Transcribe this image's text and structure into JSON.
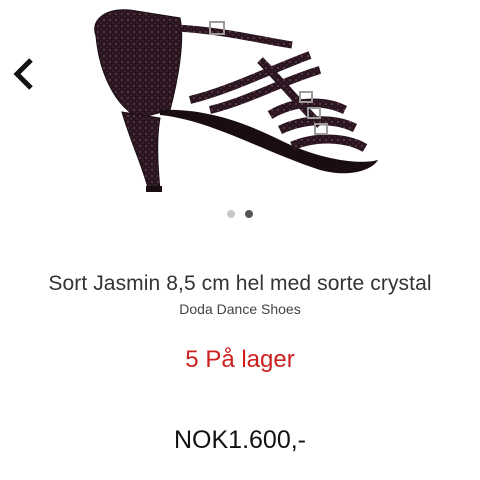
{
  "product": {
    "title": "Sort Jasmin 8,5 cm hel med sorte crystal",
    "brand": "Doda Dance Shoes",
    "stock_text": "5 På lager",
    "price": "NOK1.600,-",
    "image_icon": "shoe-image"
  },
  "carousel": {
    "total": 2,
    "active_index": 1
  },
  "nav": {
    "back_icon": "chevron-left-icon"
  },
  "colors": {
    "stock": "#cc1f1f",
    "dot_active": "#555555",
    "dot_inactive": "#c8c8c8"
  }
}
